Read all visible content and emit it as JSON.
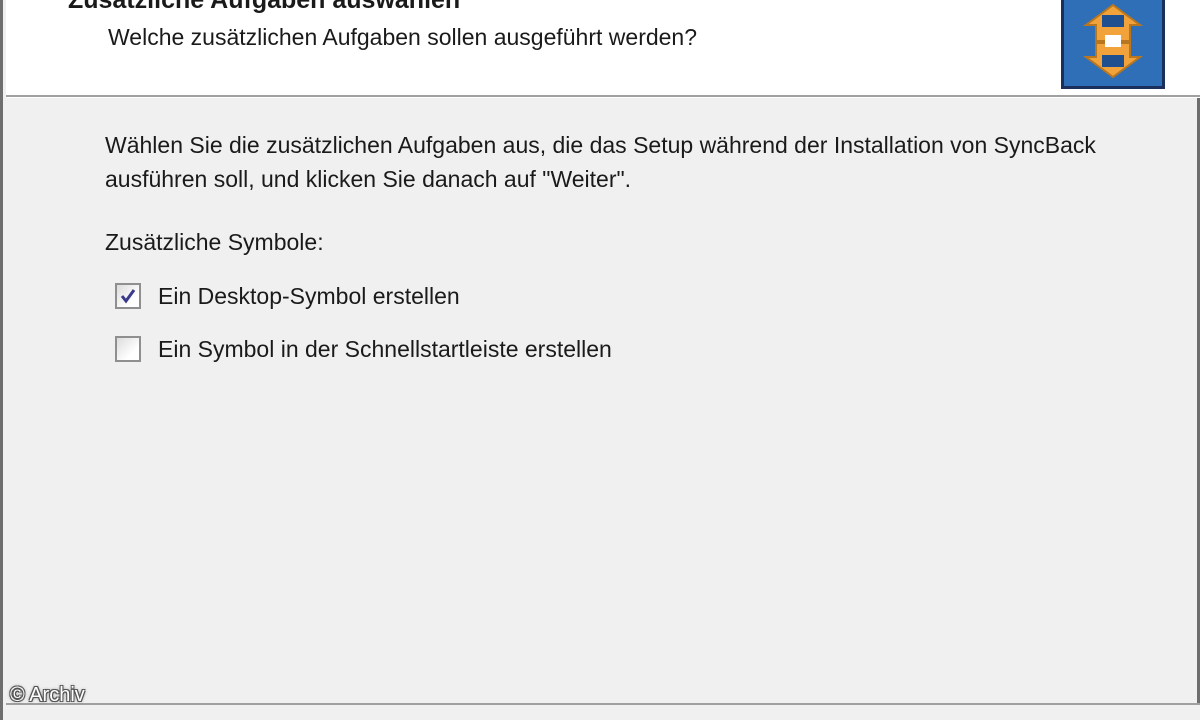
{
  "header": {
    "title": "Zusätzliche Aufgaben auswählen",
    "subtitle": "Welche zusätzlichen Aufgaben sollen ausgeführt werden?",
    "logo_icon": "syncback-logo-icon"
  },
  "content": {
    "description": "Wählen Sie die zusätzlichen Aufgaben aus, die das Setup während der Installation von SyncBack ausführen soll, und klicken Sie danach auf \"Weiter\".",
    "group_label": "Zusätzliche Symbole:",
    "tasks": [
      {
        "label": "Ein Desktop-Symbol erstellen",
        "checked": true
      },
      {
        "label": "Ein Symbol in der Schnellstartleiste erstellen",
        "checked": false
      }
    ]
  },
  "watermark": "© Archiv",
  "colors": {
    "logo_background": "#2f6fb8",
    "logo_orange": "#f2a23a",
    "check_mark": "#3a3a8c"
  }
}
